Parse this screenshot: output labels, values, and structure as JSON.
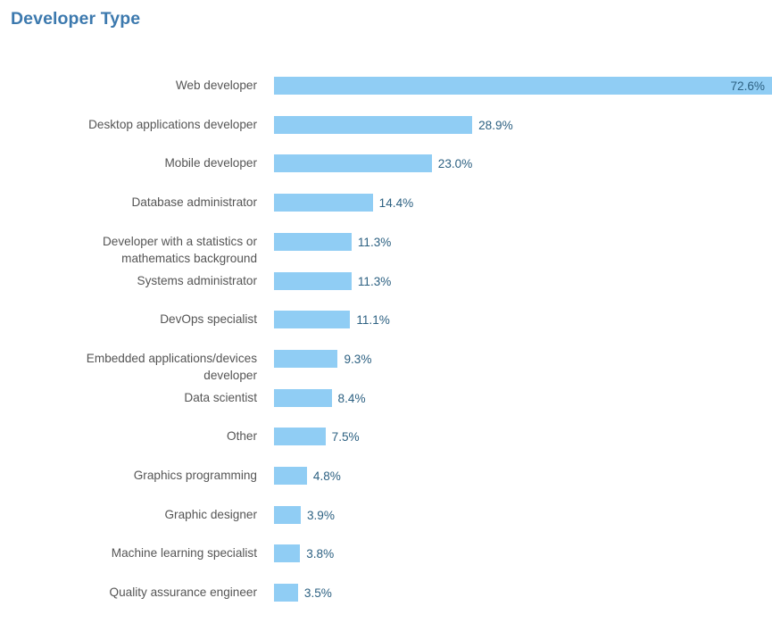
{
  "chart": {
    "title": "Developer Type",
    "title_color": "#3c79ae",
    "bar_color": "#90cdf4",
    "label_color": "#555555",
    "value_color": "#2d6182",
    "background": "#ffffff"
  },
  "chart_data": {
    "type": "bar",
    "orientation": "horizontal",
    "title": "Developer Type",
    "xlabel": "",
    "ylabel": "",
    "grid": false,
    "legend": null,
    "value_suffix": "%",
    "xlim": [
      0,
      72.6
    ],
    "categories": [
      "Web developer",
      "Desktop applications developer",
      "Mobile developer",
      "Database administrator",
      "Developer with a statistics or\nmathematics background",
      "Systems administrator",
      "DevOps specialist",
      "Embedded applications/devices\ndeveloper",
      "Data scientist",
      "Other",
      "Graphics programming",
      "Graphic designer",
      "Machine learning specialist",
      "Quality assurance engineer"
    ],
    "values": [
      72.6,
      28.9,
      23.0,
      14.4,
      11.3,
      11.3,
      11.1,
      9.3,
      8.4,
      7.5,
      4.8,
      3.9,
      3.8,
      3.5
    ],
    "value_labels": [
      "72.6%",
      "28.9%",
      "23.0%",
      "14.4%",
      "11.3%",
      "11.3%",
      "11.1%",
      "9.3%",
      "8.4%",
      "7.5%",
      "4.8%",
      "3.9%",
      "3.8%",
      "3.5%"
    ]
  }
}
